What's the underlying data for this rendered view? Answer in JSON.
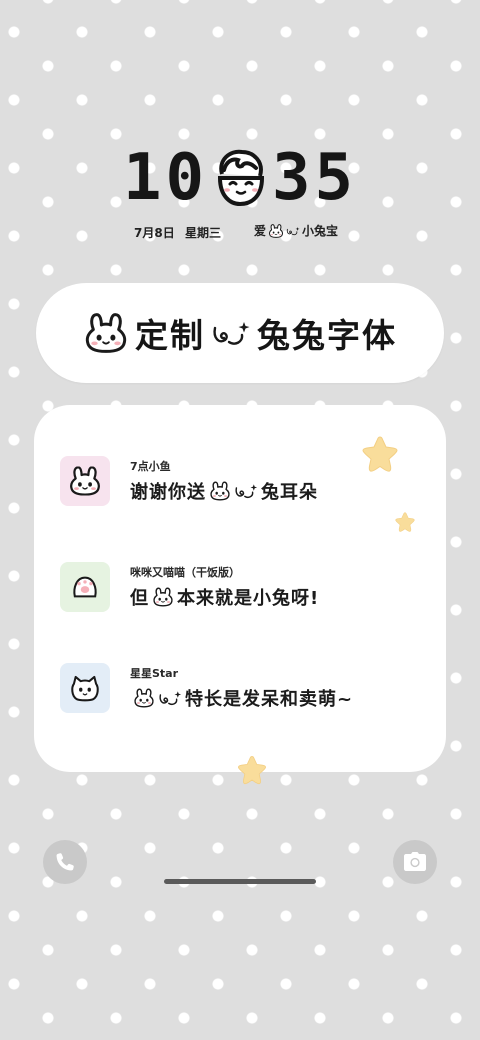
{
  "lockscreen": {
    "time_left": "10",
    "time_right": "35",
    "date": "7月8日",
    "weekday": "星期三",
    "greeting_prefix": "爱",
    "greeting_suffix": "小兔宝"
  },
  "banner": {
    "title_part1": "定制",
    "title_part2": "兔兔字体"
  },
  "notifications": [
    {
      "name": "7点小鱼",
      "text_prefix": "谢谢你送",
      "text_suffix": "兔耳朵",
      "avatar_bg": "#f7e3ee"
    },
    {
      "name": "咪咪又喵喵（干饭版）",
      "text_prefix": "但",
      "text_suffix": "本来就是小兔呀!",
      "avatar_bg": "#e6f3e1"
    },
    {
      "name": "星星Star",
      "text_prefix": "",
      "text_suffix": "特长是发呆和卖萌~",
      "avatar_bg": "#e3edf7"
    }
  ],
  "icons": {
    "left_button": "phone-icon",
    "right_button": "camera-icon"
  },
  "colors": {
    "background": "#dedede",
    "star": "#f8dc9a",
    "text": "#1c1c1c"
  }
}
